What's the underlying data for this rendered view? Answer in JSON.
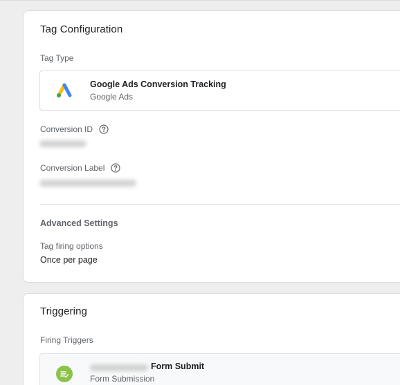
{
  "tag_configuration": {
    "title": "Tag Configuration",
    "tag_type_label": "Tag Type",
    "tag_type": {
      "name": "Google Ads Conversion Tracking",
      "vendor": "Google Ads",
      "icon": "google-ads-logo"
    },
    "fields": [
      {
        "label": "Conversion ID",
        "help_icon": "help-circle-icon"
      },
      {
        "label": "Conversion Label",
        "help_icon": "help-circle-icon"
      }
    ],
    "advanced": {
      "title": "Advanced Settings",
      "firing_options_label": "Tag firing options",
      "firing_options_value": "Once per page"
    }
  },
  "triggering": {
    "title": "Triggering",
    "firing_triggers_label": "Firing Triggers",
    "trigger": {
      "name": "Form Submit",
      "type": "Form Submission",
      "icon": "form-submission-icon",
      "icon_color": "#8bc34a"
    }
  },
  "colors": {
    "background": "#eeeeee",
    "card": "#ffffff",
    "ads_blue": "#4285f4",
    "ads_yellow": "#fbbc04",
    "ads_green": "#34a853"
  }
}
